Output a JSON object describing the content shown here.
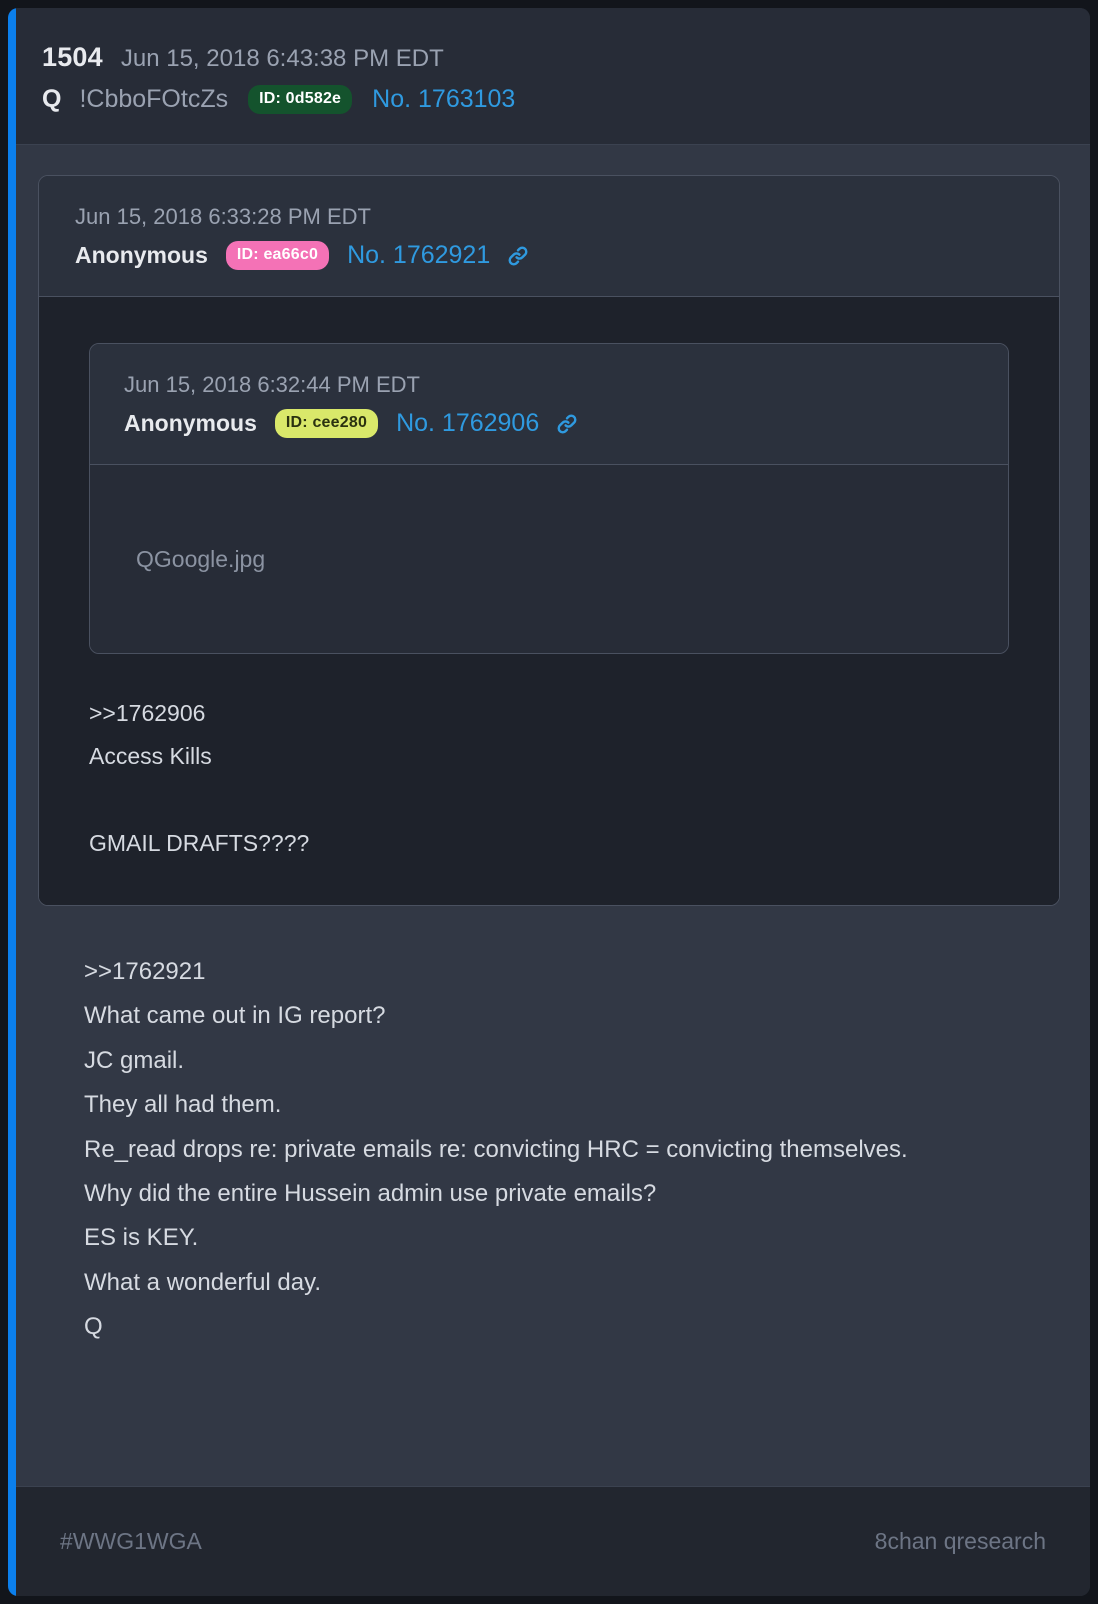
{
  "theme": {
    "accent_rail": "#0b7fec",
    "link_color": "#2f9ae0",
    "card_bg": "#323845",
    "header_bg": "#272c37"
  },
  "header": {
    "drop_number": "1504",
    "timestamp": "Jun 15, 2018 6:43:38 PM EDT",
    "poster_name": "Q",
    "tripcode": "!CbboFOtcZs",
    "id_badge": "ID: 0d582e",
    "post_no": "No. 1763103"
  },
  "quote_outer": {
    "timestamp": "Jun 15, 2018 6:33:28 PM EDT",
    "author": "Anonymous",
    "id_badge": "ID: ea66c0",
    "post_no": "No. 1762921",
    "link_icon": "link-icon",
    "text": ">>1762906\nAccess Kills\n\nGMAIL DRAFTS????"
  },
  "quote_inner": {
    "timestamp": "Jun 15, 2018 6:32:44 PM EDT",
    "author": "Anonymous",
    "id_badge": "ID: cee280",
    "post_no": "No. 1762906",
    "link_icon": "link-icon",
    "attachment_filename": "QGoogle.jpg"
  },
  "main_post": {
    "text": ">>1762921\nWhat came out in IG report?\nJC gmail.\nThey all had them.\nRe_read drops re: private emails re: convicting HRC = convicting themselves.\nWhy did the entire Hussein admin use private emails?\nES is KEY.\nWhat a wonderful day.\nQ"
  },
  "footer": {
    "left": "#WWG1WGA",
    "right": "8chan qresearch"
  }
}
